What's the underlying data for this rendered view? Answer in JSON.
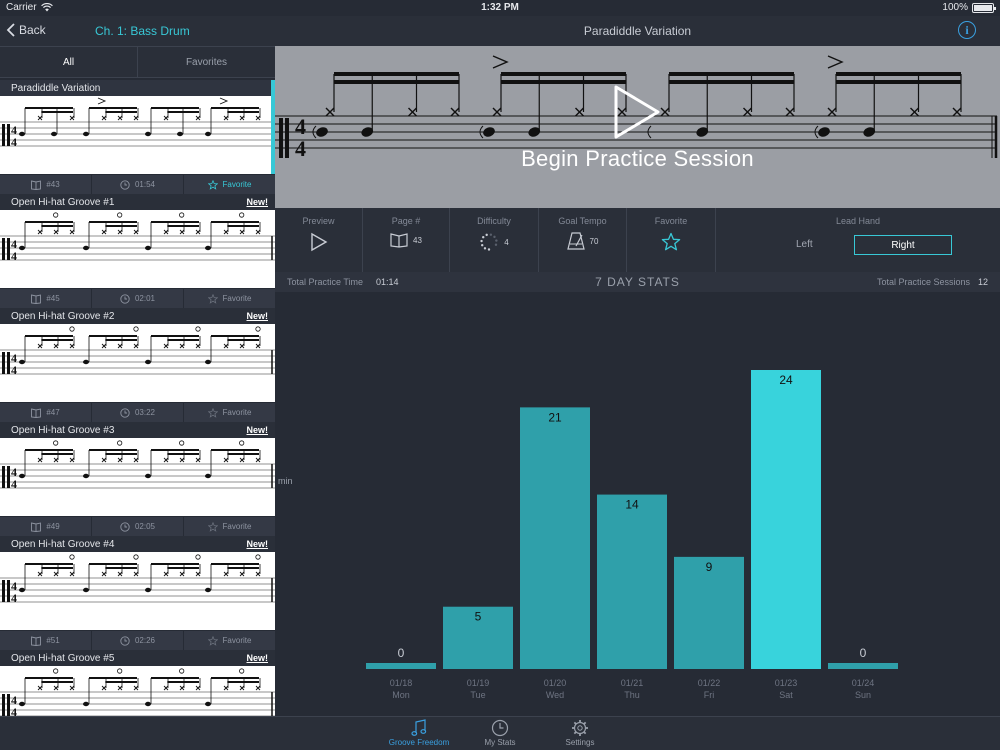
{
  "status_bar": {
    "carrier": "Carrier",
    "time": "1:32 PM",
    "battery": "100%",
    "battery_level": 1.0
  },
  "left_header": {
    "back_label": "Back",
    "chapter": "Ch. 1: Bass Drum"
  },
  "filter_tabs": [
    {
      "label": "All",
      "selected": true
    },
    {
      "label": "Favorites",
      "selected": false
    }
  ],
  "grooves": [
    {
      "title": "Paradiddle Variation",
      "new_label": "",
      "page": "#43",
      "duration": "01:54",
      "favorite_label": "Favorite",
      "favorite": true,
      "selected": true
    },
    {
      "title": "Open Hi-hat Groove #1",
      "new_label": "New!",
      "page": "#45",
      "duration": "02:01",
      "favorite_label": "Favorite",
      "favorite": false,
      "selected": false
    },
    {
      "title": "Open Hi-hat Groove #2",
      "new_label": "New!",
      "page": "#47",
      "duration": "03:22",
      "favorite_label": "Favorite",
      "favorite": false,
      "selected": false
    },
    {
      "title": "Open Hi-hat Groove #3",
      "new_label": "New!",
      "page": "#49",
      "duration": "02:05",
      "favorite_label": "Favorite",
      "favorite": false,
      "selected": false
    },
    {
      "title": "Open Hi-hat Groove #4",
      "new_label": "New!",
      "page": "#51",
      "duration": "02:26",
      "favorite_label": "Favorite",
      "favorite": false,
      "selected": false
    },
    {
      "title": "Open Hi-hat Groove #5",
      "new_label": "New!",
      "page": "",
      "duration": "",
      "favorite_label": "",
      "favorite": false,
      "selected": false
    }
  ],
  "main": {
    "title": "Paradiddle Variation",
    "info_label": "i",
    "begin_label": "Begin Practice Session",
    "controls": {
      "preview_label": "Preview",
      "page_label": "Page #",
      "page_value": "43",
      "difficulty_label": "Difficulty",
      "difficulty_value": "4",
      "tempo_label": "Goal Tempo",
      "tempo_value": "70",
      "favorite_label": "Favorite",
      "lead_hand_label": "Lead Hand",
      "lead_left": "Left",
      "lead_right": "Right",
      "lead_selected": "Right"
    },
    "stats": {
      "total_time_label": "Total Practice Time",
      "total_time_value": "01:14",
      "heading": "7 DAY STATS",
      "total_sessions_label": "Total Practice Sessions",
      "total_sessions_value": "12",
      "unit_label": "min"
    }
  },
  "chart_data": {
    "type": "bar",
    "title": "7 DAY STATS",
    "xlabel": "",
    "ylabel": "min",
    "categories": [
      "01/18",
      "01/19",
      "01/20",
      "01/21",
      "01/22",
      "01/23",
      "01/24"
    ],
    "days": [
      "Mon",
      "Tue",
      "Wed",
      "Thu",
      "Fri",
      "Sat",
      "Sun"
    ],
    "values": [
      0,
      5,
      21,
      14,
      9,
      24,
      0
    ],
    "highlight_index": 5,
    "ylim": [
      0,
      24
    ],
    "grid": false,
    "bar_color": "#2fa0aa",
    "highlight_color": "#38d3dc"
  },
  "tabs": [
    {
      "label": "Groove Freedom",
      "icon": "music-note-icon",
      "active": true
    },
    {
      "label": "My Stats",
      "icon": "clock-icon",
      "active": false
    },
    {
      "label": "Settings",
      "icon": "gear-icon",
      "active": false
    }
  ],
  "colors": {
    "accent": "#38c8d6",
    "background": "#262b35",
    "panel": "#2a2f39",
    "info_blue": "#3aa0e0"
  }
}
